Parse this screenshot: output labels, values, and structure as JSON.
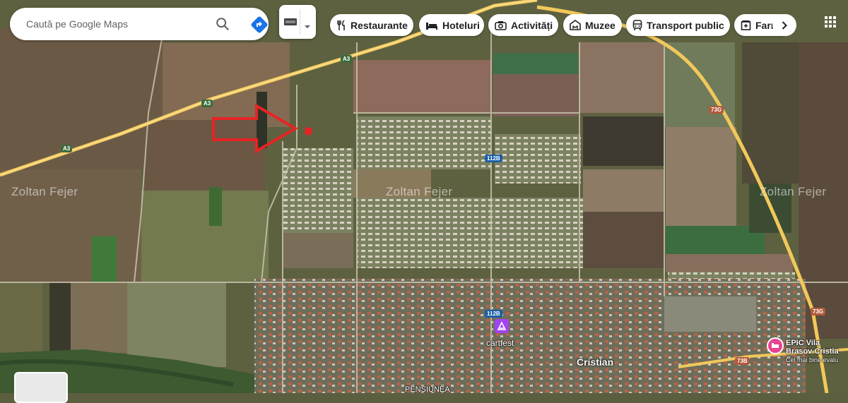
{
  "search": {
    "placeholder": "Caută pe Google Maps"
  },
  "chips": [
    {
      "label": "Restaurante",
      "icon": "fork-knife-icon"
    },
    {
      "label": "Hoteluri",
      "icon": "bed-icon"
    },
    {
      "label": "Activități",
      "icon": "camera-icon"
    },
    {
      "label": "Muzee",
      "icon": "museum-icon"
    },
    {
      "label": "Transport public",
      "icon": "train-icon"
    },
    {
      "label": "Farm",
      "icon": "pharmacy-icon"
    }
  ],
  "watermark": "Zoltan Fejer",
  "places": {
    "cristian": "Cristian",
    "cartfest": "cartfest",
    "epic": "EPIC Vila Brasov Cristia",
    "epic_sub": "Cel mai bine evalu",
    "bottom": "PENSIUNEA"
  },
  "roads": {
    "a3": "A3",
    "r73g": "73G",
    "r112b": "112B",
    "r73b": "73B"
  },
  "colors": {
    "highway": "#f1c85a",
    "arrow": "#e62424",
    "place_marker": "#a142f4",
    "hotel_marker": "#e84393"
  }
}
